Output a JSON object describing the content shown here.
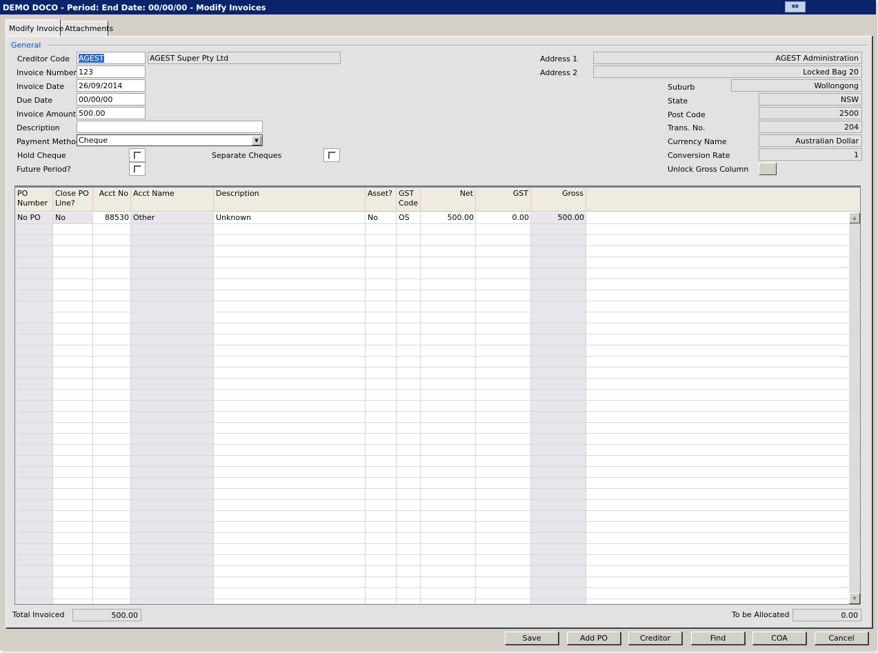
{
  "window": {
    "title": "DEMO DOCO  - Period:  End Date: 00/00/00 - Modify Invoices",
    "restore_icon": "⇔"
  },
  "tabs": [
    {
      "label": "Modify Invoice",
      "active": true
    },
    {
      "label": "Attachments",
      "active": false
    }
  ],
  "general": {
    "group_label": "General",
    "creditor_code": {
      "label": "Creditor Code",
      "value": "AGEST",
      "name": "AGEST Super Pty Ltd"
    },
    "invoice_number": {
      "label": "Invoice Number",
      "value": "123"
    },
    "invoice_date": {
      "label": "Invoice Date",
      "value": "26/09/2014"
    },
    "due_date": {
      "label": "Due Date",
      "value": "00/00/00"
    },
    "invoice_amount": {
      "label": "Invoice Amount",
      "value": "500.00"
    },
    "description": {
      "label": "Description",
      "value": ""
    },
    "payment_method": {
      "label": "Payment Method",
      "value": "Cheque"
    },
    "hold_cheque": {
      "label": "Hold Cheque",
      "checked": false
    },
    "separate_cheques": {
      "label": "Separate Cheques",
      "checked": false
    },
    "future_period": {
      "label": "Future Period?",
      "checked": false
    },
    "address1": {
      "label": "Address 1",
      "value": "AGEST Administration"
    },
    "address2": {
      "label": "Address 2",
      "value": "Locked Bag 20"
    },
    "suburb": {
      "label": "Suburb",
      "value": "Wollongong"
    },
    "state": {
      "label": "State",
      "value": "NSW"
    },
    "post_code": {
      "label": "Post Code",
      "value": "2500"
    },
    "trans_no": {
      "label": "Trans. No.",
      "value": "204"
    },
    "currency_name": {
      "label": "Currency Name",
      "value": "Australian Dollar"
    },
    "conversion_rate": {
      "label": "Conversion Rate",
      "value": "1"
    },
    "unlock_gross": {
      "label": "Unlock Gross Column"
    }
  },
  "grid": {
    "columns": [
      {
        "key": "po_number",
        "label1": "PO",
        "label2": "Number"
      },
      {
        "key": "close_po",
        "label1": "Close PO",
        "label2": "Line?"
      },
      {
        "key": "acct_no",
        "label1": "Acct No",
        "label2": ""
      },
      {
        "key": "acct_name",
        "label1": "Acct Name",
        "label2": ""
      },
      {
        "key": "description",
        "label1": "Description",
        "label2": ""
      },
      {
        "key": "asset",
        "label1": "Asset?",
        "label2": ""
      },
      {
        "key": "gst_code",
        "label1": "GST",
        "label2": "Code"
      },
      {
        "key": "net",
        "label1": "Net",
        "label2": ""
      },
      {
        "key": "gst",
        "label1": "GST",
        "label2": ""
      },
      {
        "key": "gross",
        "label1": "Gross",
        "label2": ""
      }
    ],
    "rows": [
      {
        "po_number": "No PO",
        "close_po": "No",
        "acct_no": "88530",
        "acct_name": "Other",
        "description": "Unknown",
        "asset": "No",
        "gst_code": "OS",
        "net": "500.00",
        "gst": "0.00",
        "gross": "500.00"
      }
    ]
  },
  "totals": {
    "total_invoiced": {
      "label": "Total Invoiced",
      "value": "500.00"
    },
    "to_be_allocated": {
      "label": "To be Allocated",
      "value": "0.00"
    }
  },
  "buttons": {
    "save": "Save",
    "add_po": "Add PO",
    "creditor": "Creditor",
    "find": "Find",
    "coa": "COA",
    "cancel": "Cancel"
  }
}
